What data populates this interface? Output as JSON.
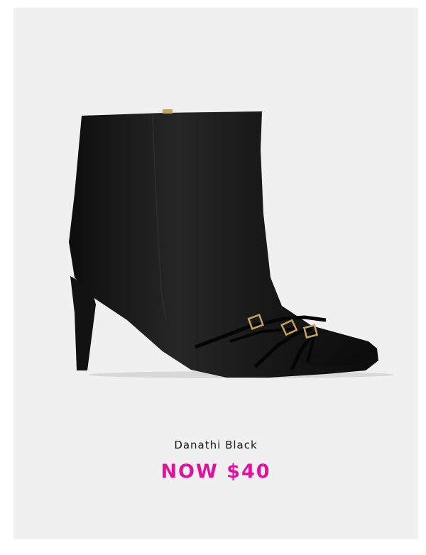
{
  "product": {
    "name": "Danathi Black",
    "price_label": "NOW $40",
    "image_icon": "black-stiletto-ankle-boot-image",
    "price_color": "#e0119c",
    "card_background": "#f0f0f0",
    "boot_color": "#151515",
    "buckle_color": "#c9a25a"
  }
}
